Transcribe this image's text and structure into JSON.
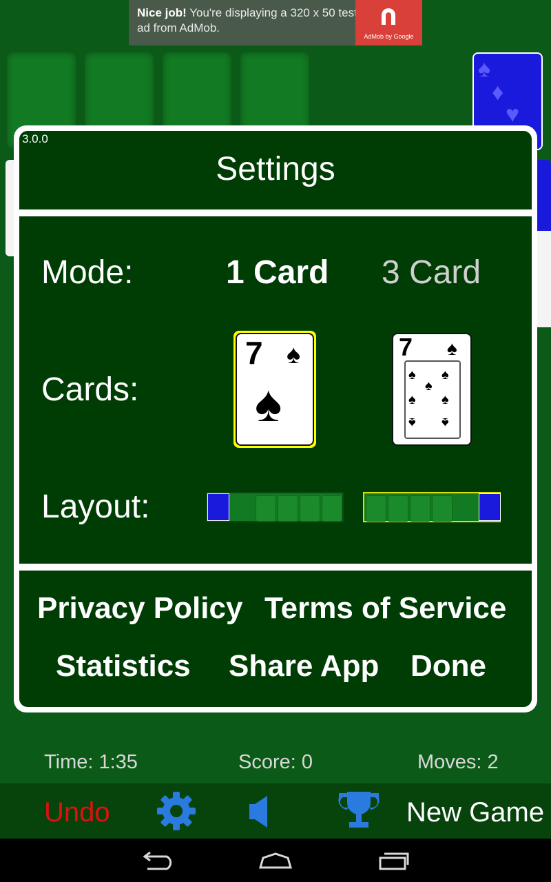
{
  "ad": {
    "headline": "Nice job!",
    "text": " You're displaying a 320 x 50 test ad from AdMob.",
    "logo_text": "AdMob by Google"
  },
  "dialog": {
    "version": "3.0.0",
    "title": "Settings",
    "mode_label": "Mode:",
    "mode_options": [
      "1 Card",
      "3 Card"
    ],
    "mode_selected": "1 Card",
    "cards_label": "Cards:",
    "card_rank": "7",
    "layout_label": "Layout:",
    "links": {
      "privacy": "Privacy Policy",
      "terms": "Terms of Service",
      "statistics": "Statistics",
      "share": "Share App",
      "done": "Done"
    }
  },
  "status": {
    "time": "Time: 1:35",
    "score": "Score: 0",
    "moves": "Moves: 2"
  },
  "toolbar": {
    "undo": "Undo",
    "new_game": "New Game"
  },
  "colors": {
    "felt": "#0b5a18",
    "dialog_bg": "#003d05",
    "undo": "#e01010",
    "icon_blue": "#2a7ae0",
    "selected_outline": "#ffff00"
  }
}
